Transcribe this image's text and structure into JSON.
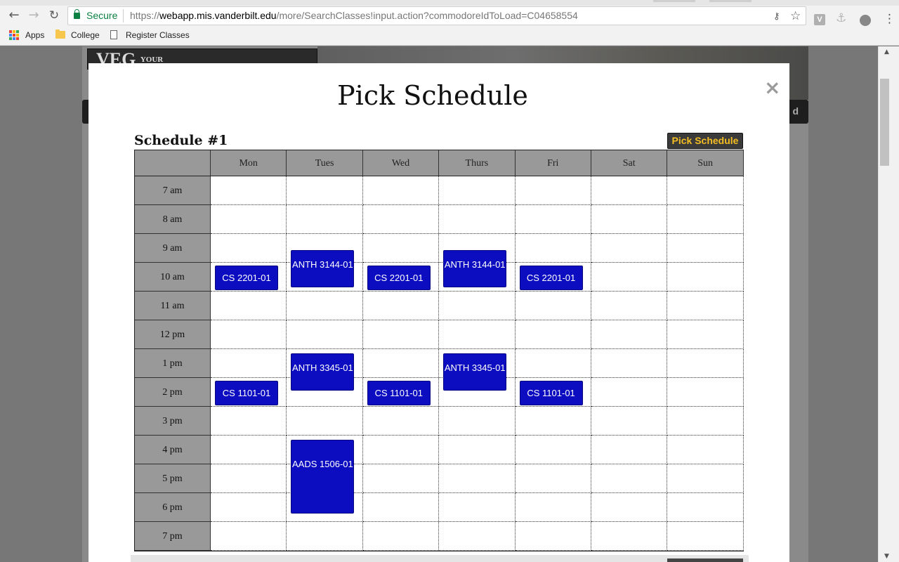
{
  "browser": {
    "secure_label": "Secure",
    "url_scheme": "https://",
    "url_host": "webapp.mis.vanderbilt.edu",
    "url_path": "/more/SearchClasses!input.action?commodoreIdToLoad=C04658554",
    "ext_v_label": "V"
  },
  "bookmarks": [
    {
      "label": "Apps",
      "icon": "apps-grid-icon"
    },
    {
      "label": "College",
      "icon": "folder-icon"
    },
    {
      "label": "Register Classes",
      "icon": "page-icon"
    }
  ],
  "site": {
    "header_partial": "VEG",
    "header_partial_small": "YOUR",
    "nav_tail": "d"
  },
  "modal": {
    "title": "Pick Schedule",
    "close_symbol": "×",
    "schedule_heading": "Schedule #1",
    "pick_button_label": "Pick Schedule"
  },
  "schedule": {
    "days": [
      "Mon",
      "Tues",
      "Wed",
      "Thurs",
      "Fri",
      "Sat",
      "Sun"
    ],
    "times": [
      "7 am",
      "8 am",
      "9 am",
      "10 am",
      "11 am",
      "12 pm",
      "1 pm",
      "2 pm",
      "3 pm",
      "4 pm",
      "5 pm",
      "6 pm",
      "7 pm"
    ],
    "courses": [
      {
        "label": "CS 2201-01",
        "day": "Mon"
      },
      {
        "label": "ANTH 3144-01",
        "day": "Tues"
      },
      {
        "label": "CS 2201-01",
        "day": "Wed"
      },
      {
        "label": "ANTH 3144-01",
        "day": "Thurs"
      },
      {
        "label": "CS 2201-01",
        "day": "Fri"
      },
      {
        "label": "CS 1101-01",
        "day": "Mon"
      },
      {
        "label": "ANTH 3345-01",
        "day": "Tues"
      },
      {
        "label": "CS 1101-01",
        "day": "Wed"
      },
      {
        "label": "ANTH 3345-01",
        "day": "Thurs"
      },
      {
        "label": "CS 1101-01",
        "day": "Fri"
      },
      {
        "label": "AADS 1506-01",
        "day": "Tues"
      }
    ]
  },
  "colors": {
    "course_block": "#0c0cc0",
    "pick_button_text": "#f4bd23",
    "secure_green": "#0b8043"
  }
}
